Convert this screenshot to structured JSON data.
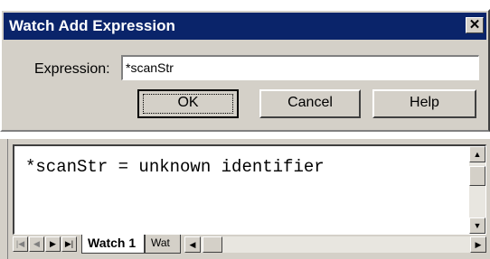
{
  "dialog": {
    "title": "Watch Add Expression",
    "close_glyph": "✕",
    "expression_label": "Expression:",
    "expression_value": "*scanStr",
    "buttons": {
      "ok": "OK",
      "cancel": "Cancel",
      "help": "Help"
    }
  },
  "watch": {
    "content": "*scanStr = unknown identifier",
    "tabs": {
      "active": "Watch 1",
      "other": "Wat"
    },
    "icons": {
      "first": "first-page-icon",
      "prev": "prev-page-icon",
      "next": "next-page-icon",
      "last": "last-page-icon",
      "up": "scroll-up-arrow-icon",
      "down": "scroll-down-arrow-icon",
      "left": "scroll-left-arrow-icon",
      "right": "scroll-right-arrow-icon"
    }
  },
  "colors": {
    "titlebar": "#0a246a",
    "face": "#d4d0c8"
  }
}
